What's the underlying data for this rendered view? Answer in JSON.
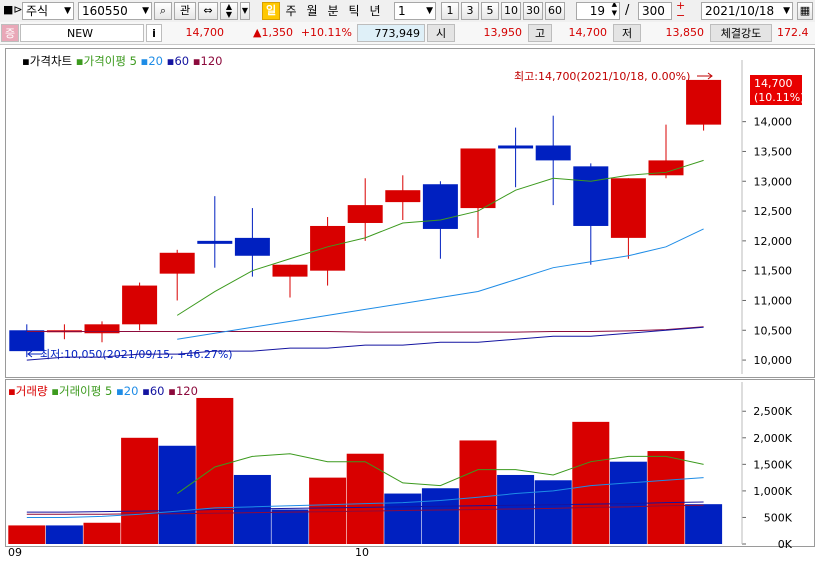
{
  "toolbar": {
    "market_select": "주식",
    "code_value": "160550",
    "search_glyph": "⌕",
    "gwan_label": "관",
    "period_active": "일",
    "periods": [
      "주",
      "월",
      "분",
      "틱",
      "년"
    ],
    "unit_value": "1",
    "quick_counts": [
      "1",
      "3",
      "5",
      "10",
      "30",
      "60"
    ],
    "page_current": "19",
    "page_sep": "/",
    "page_total": "300",
    "date_value": "2021/10/18"
  },
  "quote": {
    "badge": "증",
    "name": "NEW",
    "info_label": "i",
    "price": "14,700",
    "change": "▲1,350",
    "change_pct": "+10.11%",
    "volume": "773,949",
    "open_label": "시",
    "open_value": "13,950",
    "high_label": "고",
    "high_value": "14,700",
    "low_label": "저",
    "low_value": "13,850",
    "strength_label": "체결강도",
    "strength_value": "172.4"
  },
  "price_panel": {
    "title": "가격차트",
    "ma_title": "가격이평",
    "ma_periods": [
      "5",
      "20",
      "60",
      "120"
    ],
    "max_note": "최고:14,700(2021/10/18, 0.00%)",
    "min_note": "최저:10,050(2021/09/15, +46.27%)",
    "last_price": "14,700",
    "last_change": "(10.11%)",
    "y_ticks": [
      "14,000",
      "13,500",
      "13,000",
      "12,500",
      "12,000",
      "11,500",
      "11,000",
      "10,500",
      "10,000"
    ]
  },
  "volume_panel": {
    "title": "거래량",
    "ma_title": "거래이평",
    "ma_periods": [
      "5",
      "20",
      "60",
      "120"
    ],
    "y_ticks": [
      "2,500K",
      "2,000K",
      "1,500K",
      "1,000K",
      "500K",
      "0K"
    ]
  },
  "x_labels": [
    "09",
    "10"
  ],
  "colors": {
    "up": "#d80000",
    "down": "#0020c0",
    "ma5": "#3c9a1e",
    "ma20": "#1e8ce6",
    "ma60": "#1414a0",
    "ma120": "#8c0a3c"
  },
  "chart_data": [
    {
      "type": "candlestick",
      "title": "가격차트",
      "ylim": [
        9800,
        14900
      ],
      "candles": [
        {
          "o": 10500,
          "h": 10600,
          "l": 10050,
          "c": 10150
        },
        {
          "o": 10500,
          "h": 10600,
          "l": 10350,
          "c": 10500
        },
        {
          "o": 10450,
          "h": 10650,
          "l": 10300,
          "c": 10600
        },
        {
          "o": 10600,
          "h": 11300,
          "l": 10500,
          "c": 11250
        },
        {
          "o": 11450,
          "h": 11850,
          "l": 11000,
          "c": 11800
        },
        {
          "o": 12000,
          "h": 12750,
          "l": 11550,
          "c": 11950
        },
        {
          "o": 12050,
          "h": 12550,
          "l": 11400,
          "c": 11750
        },
        {
          "o": 11400,
          "h": 11600,
          "l": 11050,
          "c": 11600
        },
        {
          "o": 11500,
          "h": 12400,
          "l": 11250,
          "c": 12250
        },
        {
          "o": 12300,
          "h": 13050,
          "l": 12000,
          "c": 12600
        },
        {
          "o": 12650,
          "h": 13100,
          "l": 12350,
          "c": 12850
        },
        {
          "o": 12950,
          "h": 13000,
          "l": 11700,
          "c": 12200
        },
        {
          "o": 12550,
          "h": 13550,
          "l": 12050,
          "c": 13550
        },
        {
          "o": 13600,
          "h": 13900,
          "l": 12900,
          "c": 13550
        },
        {
          "o": 13600,
          "h": 14100,
          "l": 12600,
          "c": 13350
        },
        {
          "o": 13250,
          "h": 13300,
          "l": 11600,
          "c": 12250
        },
        {
          "o": 12050,
          "h": 13050,
          "l": 11700,
          "c": 13050
        },
        {
          "o": 13100,
          "h": 13950,
          "l": 13050,
          "c": 13350
        },
        {
          "o": 13950,
          "h": 14700,
          "l": 13850,
          "c": 14700
        }
      ],
      "ma5": [
        null,
        null,
        null,
        null,
        10750,
        11150,
        11500,
        11700,
        11900,
        12050,
        12300,
        12350,
        12500,
        12850,
        13050,
        13000,
        13100,
        13150,
        13350
      ],
      "ma20": [
        null,
        null,
        null,
        null,
        10350,
        10450,
        10550,
        10650,
        10750,
        10850,
        10950,
        11050,
        11150,
        11350,
        11550,
        11650,
        11750,
        11900,
        12200
      ],
      "ma60": [
        10000,
        10050,
        10050,
        10100,
        10100,
        10150,
        10150,
        10200,
        10200,
        10250,
        10250,
        10300,
        10300,
        10350,
        10400,
        10400,
        10450,
        10500,
        10550
      ],
      "ma120": [
        10480,
        10480,
        10480,
        10480,
        10480,
        10480,
        10480,
        10480,
        10480,
        10470,
        10470,
        10470,
        10470,
        10470,
        10480,
        10480,
        10490,
        10510,
        10560
      ]
    },
    {
      "type": "bar",
      "title": "거래량",
      "ylim": [
        0,
        2900
      ],
      "unit": "K",
      "bars": [
        {
          "v": 350,
          "dir": "up"
        },
        {
          "v": 350,
          "dir": "down"
        },
        {
          "v": 400,
          "dir": "up"
        },
        {
          "v": 2000,
          "dir": "up"
        },
        {
          "v": 1850,
          "dir": "down"
        },
        {
          "v": 2750,
          "dir": "up"
        },
        {
          "v": 1300,
          "dir": "down"
        },
        {
          "v": 650,
          "dir": "down"
        },
        {
          "v": 1250,
          "dir": "up"
        },
        {
          "v": 1700,
          "dir": "up"
        },
        {
          "v": 950,
          "dir": "down"
        },
        {
          "v": 1050,
          "dir": "down"
        },
        {
          "v": 1950,
          "dir": "up"
        },
        {
          "v": 1300,
          "dir": "down"
        },
        {
          "v": 1200,
          "dir": "down"
        },
        {
          "v": 2300,
          "dir": "up"
        },
        {
          "v": 1550,
          "dir": "down"
        },
        {
          "v": 1750,
          "dir": "up"
        },
        {
          "v": 750,
          "dir": "down"
        }
      ],
      "ma5": [
        null,
        null,
        null,
        null,
        950,
        1450,
        1650,
        1700,
        1550,
        1550,
        1150,
        1100,
        1400,
        1400,
        1300,
        1550,
        1650,
        1650,
        1500
      ],
      "ma20": [
        500,
        500,
        520,
        560,
        620,
        680,
        700,
        720,
        740,
        760,
        780,
        820,
        880,
        950,
        1000,
        1100,
        1150,
        1200,
        1250
      ],
      "ma60": [
        600,
        600,
        610,
        620,
        630,
        650,
        660,
        670,
        680,
        690,
        700,
        710,
        720,
        730,
        740,
        750,
        760,
        780,
        790
      ],
      "ma120": [
        560,
        560,
        560,
        570,
        570,
        580,
        590,
        600,
        610,
        620,
        630,
        640,
        650,
        660,
        670,
        690,
        700,
        720,
        730
      ]
    }
  ]
}
